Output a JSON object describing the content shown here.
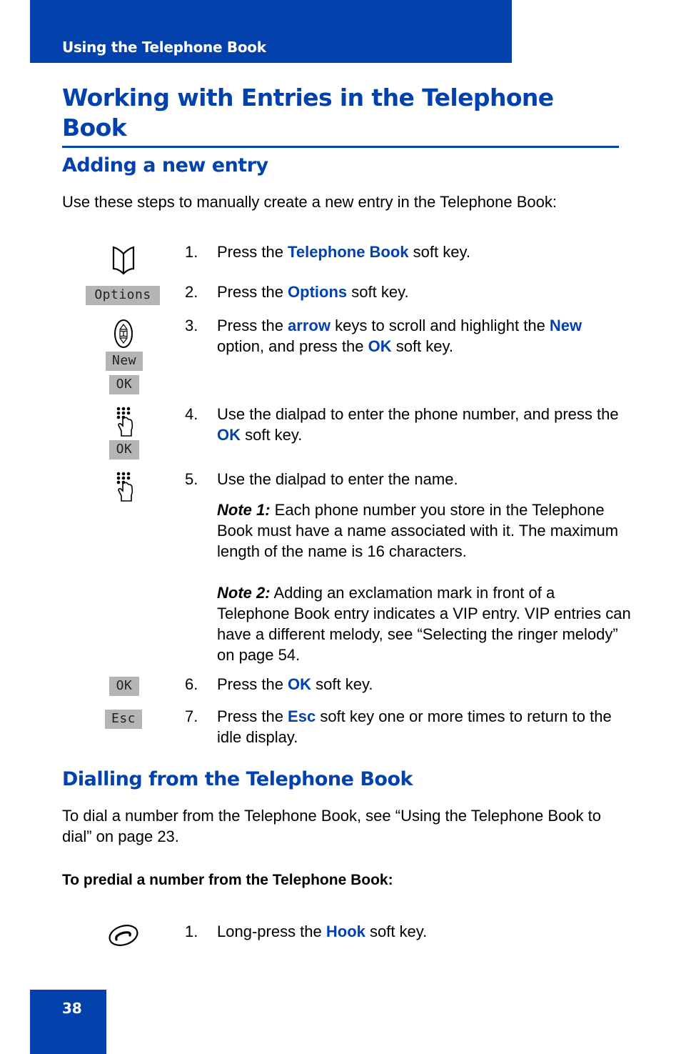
{
  "header": {
    "section": "Using the Telephone Book"
  },
  "page_title": "Working with Entries in the Telephone Book",
  "adding": {
    "heading": "Adding a new entry",
    "intro": "Use these steps to manually create a new entry in the Telephone Book:",
    "softkeys": {
      "options": "Options",
      "new": "New",
      "ok": "OK",
      "esc": "Esc"
    },
    "steps": [
      {
        "num": "1.",
        "a": "Press the ",
        "k1": "Telephone Book",
        "b": " soft key."
      },
      {
        "num": "2.",
        "a": "Press the ",
        "k1": "Options",
        "b": " soft key."
      },
      {
        "num": "3.",
        "a": "Press the ",
        "k1": "arrow",
        "b": " keys to scroll and highlight the ",
        "k2": "New",
        "c": " option, and press the ",
        "k3": "OK",
        "d": " soft key."
      },
      {
        "num": "4.",
        "a": "Use the dialpad to enter the phone number, and press the ",
        "k1": "OK",
        "b": " soft key."
      },
      {
        "num": "5.",
        "a": "Use the dialpad to enter the name."
      },
      {
        "num": "6.",
        "a": "Press the ",
        "k1": "OK",
        "b": " soft key."
      },
      {
        "num": "7.",
        "a": "Press the ",
        "k1": "Esc",
        "b": " soft key one or more times to return to the idle display."
      }
    ],
    "notes": [
      {
        "label": "Note 1:",
        "text": " Each phone number you store in the Telephone Book must have a name associated with it. The maximum length of the name is 16 characters."
      },
      {
        "label": "Note 2:",
        "text": " Adding an exclamation mark in front of a Telephone Book entry indicates a VIP entry. VIP entries can have a different melody, see “Selecting the ringer melody” on page 54."
      }
    ]
  },
  "dialling": {
    "heading": "Dialling from the Telephone Book",
    "intro": "To dial a number from the Telephone Book, see “Using the Telephone Book to dial” on page 23.",
    "subheading": "To predial a number from the Telephone Book:",
    "steps": [
      {
        "num": "1.",
        "a": "Long-press the ",
        "k1": "Hook",
        "b": " soft key."
      }
    ]
  },
  "footer": {
    "page_number": "38"
  },
  "colors": {
    "brand_blue": "#0341ac",
    "softkey_gray": "#b5b5b5"
  }
}
